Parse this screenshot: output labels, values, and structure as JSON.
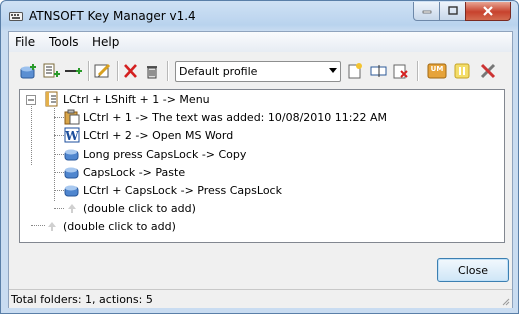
{
  "window": {
    "title": "ATNSOFT Key Manager v1.4"
  },
  "menu": {
    "file": "File",
    "tools": "Tools",
    "help": "Help"
  },
  "toolbar": {
    "profile_selected": "Default profile"
  },
  "tree": {
    "root": "LCtrl + LShift + 1 -> Menu",
    "children": [
      "LCtrl + 1 -> The text was added: 10/08/2010 11:22 AM",
      "LCtrl + 2 -> Open MS Word",
      "Long press CapsLock -> Copy",
      "CapsLock -> Paste",
      "LCtrl + CapsLock -> Press CapsLock",
      "(double click to add)"
    ],
    "add_root": "(double click to add)"
  },
  "buttons": {
    "close": "Close"
  },
  "status": {
    "text": "Total folders: 1, actions: 5"
  },
  "colors": {
    "accent_blue": "#3c7fb1",
    "close_red": "#c7422e"
  }
}
